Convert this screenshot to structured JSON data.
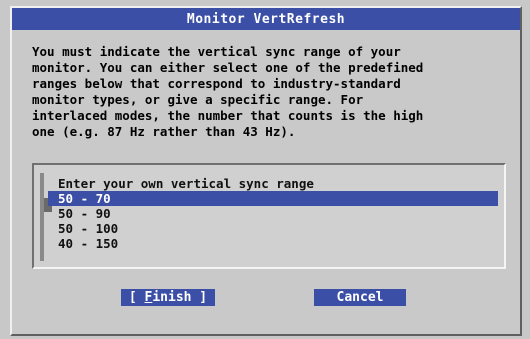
{
  "dialog": {
    "title": "Monitor VertRefresh",
    "message": "You must indicate the vertical sync range of your\nmonitor. You can either select one of the predefined\nranges below that correspond to industry-standard\nmonitor types, or give a specific range. For\ninterlaced modes, the number that counts is the high\none (e.g. 87 Hz rather than 43 Hz).",
    "list": {
      "items": [
        "Enter your own vertical sync range",
        "50 - 70",
        "50 - 90",
        "50 - 100",
        "40 - 150"
      ],
      "selected_index": 1
    },
    "buttons": {
      "finish_prefix": "[ ",
      "finish_hotkey": "F",
      "finish_rest": "inish ]",
      "cancel_label": "Cancel"
    }
  },
  "colors": {
    "accent": "#3c4fa7",
    "background": "#c9c9c9"
  }
}
